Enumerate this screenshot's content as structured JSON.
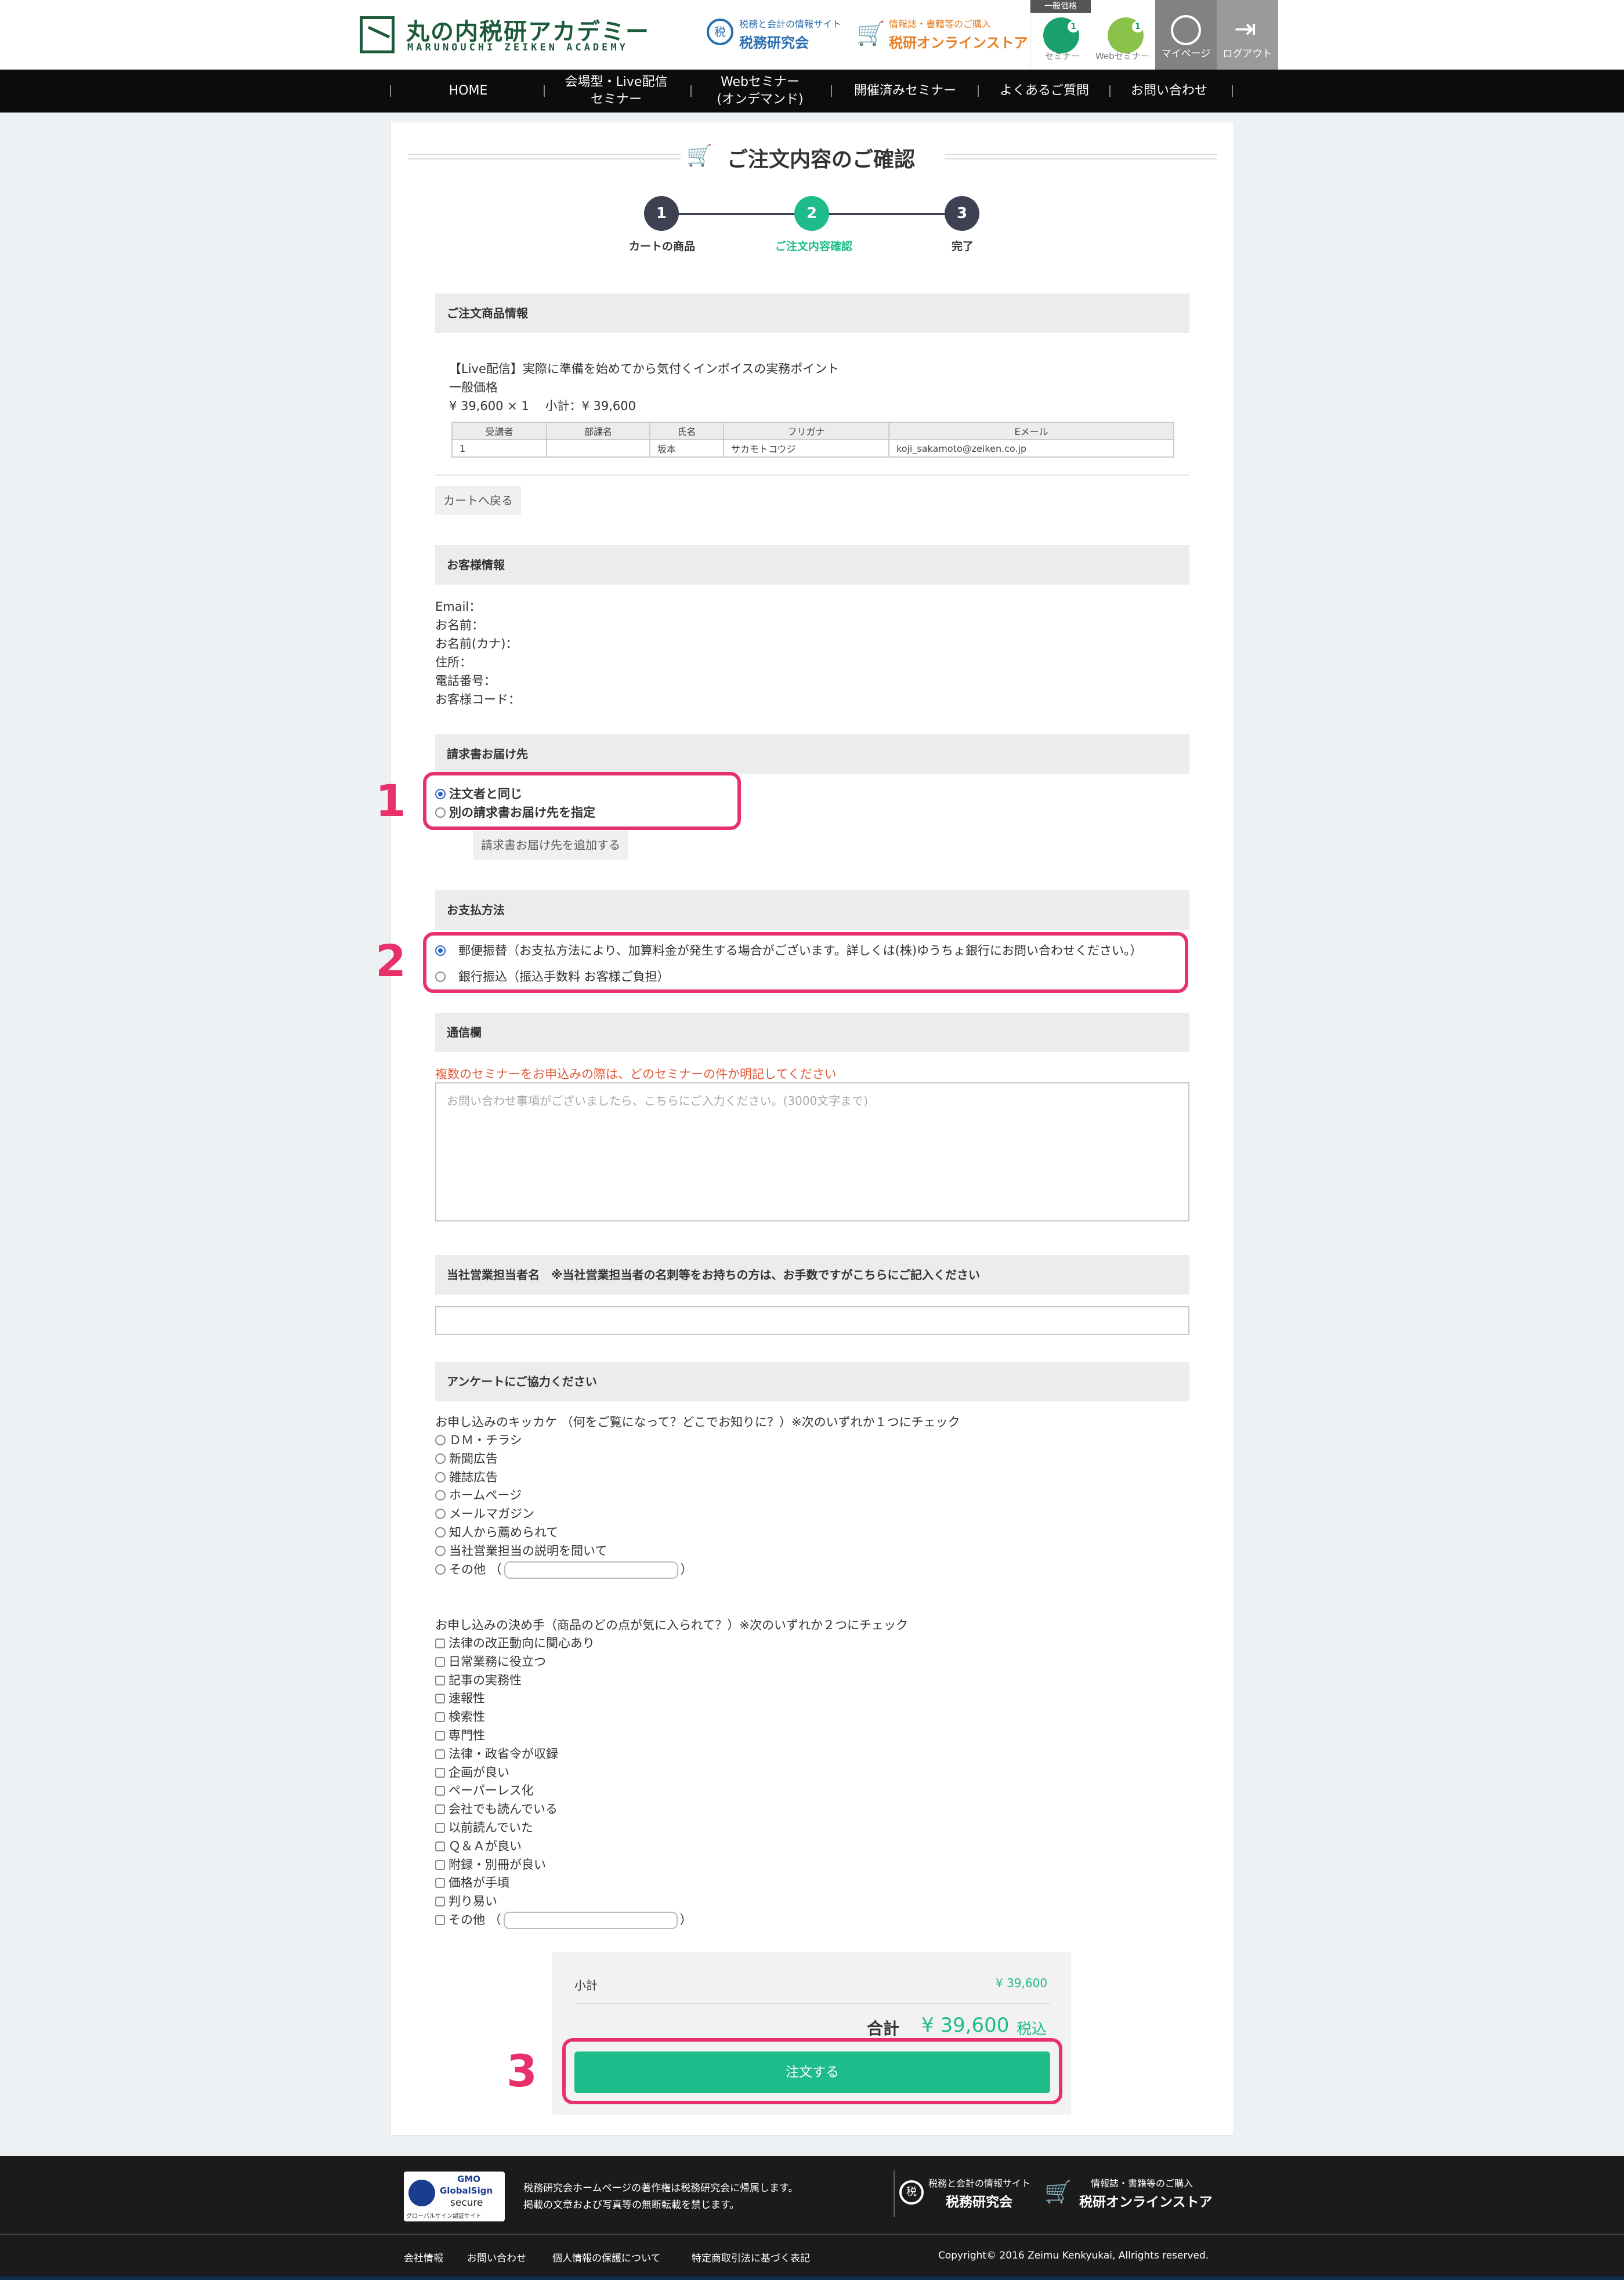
{
  "header": {
    "logo_title": "丸の内税研アカデミー",
    "logo_sub": "MARUNOUCHI ZEIKEN ACADEMY",
    "site1_small": "税務と会計の情報サイト",
    "site1_name": "税務研究会",
    "site2_small": "情報誌・書籍等のご購入",
    "site2_name": "税研オンラインストア",
    "price_type": "一般価格",
    "cart_seminar_count": "1",
    "cart_seminar_label": "セミナー",
    "cart_web_count": "1",
    "cart_web_label": "Webセミナー",
    "mypage": "マイページ",
    "logout": "ログアウト"
  },
  "nav": {
    "items": [
      "HOME",
      "会場型・Live配信\nセミナー",
      "Webセミナー\n(オンデマンド)",
      "開催済みセミナー",
      "よくあるご質問",
      "お問い合わせ"
    ]
  },
  "page": {
    "title": "ご注文内容のご確認",
    "steps": [
      {
        "num": "1",
        "label": "カートの商品"
      },
      {
        "num": "2",
        "label": "ご注文内容確認"
      },
      {
        "num": "3",
        "label": "完了"
      }
    ]
  },
  "order": {
    "section_title": "ご注文商品情報",
    "product_name": "【Live配信】実際に準備を始めてから気付くインボイスの実務ポイント",
    "price_label": "一般価格",
    "price_line": "¥ 39,600 × 1　 小計：¥ 39,600",
    "table_headers": [
      "受講者",
      "部課名",
      "氏名",
      "フリガナ",
      "Eメール"
    ],
    "table_rows": [
      [
        "1",
        "",
        "坂本",
        "サカモトコウジ",
        "koji_sakamoto@zeiken.co.jp"
      ]
    ],
    "back_button": "カートへ戻る"
  },
  "customer": {
    "section_title": "お客様情報",
    "fields": [
      "Email：",
      "お名前：",
      "お名前(カナ)：",
      "住所：",
      "電話番号：",
      "お客様コード："
    ]
  },
  "invoice": {
    "section_title": "請求書お届け先",
    "options": [
      "注文者と同じ",
      "別の請求書お届け先を指定"
    ],
    "selected": 0,
    "add_button": "請求書お届け先を追加する"
  },
  "payment": {
    "section_title": "お支払方法",
    "options": [
      "郵便振替（お支払方法により、加算料金が発生する場合がございます。詳しくは(株)ゆうちょ銀行にお問い合わせください。）",
      "銀行振込（振込手数料 お客様ご負担）"
    ],
    "selected": 0
  },
  "message": {
    "section_title": "通信欄",
    "note": "複数のセミナーをお申込みの際は、どのセミナーの件か明記してください",
    "placeholder": "お問い合わせ事項がございましたら、こちらにご入力ください。(3000文字まで)"
  },
  "sales_rep": {
    "section_title": "当社営業担当者名　※当社営業担当者の名刺等をお持ちの方は、お手数ですがこちらにご記入ください",
    "value": ""
  },
  "survey": {
    "section_title": "アンケートにご協力ください",
    "q1": "お申し込みのキッカケ （何をご覧になって？どこでお知りに？）※次のいずれか１つにチェック",
    "q1_options": [
      "ＤＭ・チラシ",
      "新聞広告",
      "雑誌広告",
      "ホームページ",
      "メールマガジン",
      "知人から薦められて",
      "当社営業担当の説明を聞いて",
      "その他 （"
    ],
    "q2": "お申し込みの決め手（商品のどの点が気に入られて？）※次のいずれか２つにチェック",
    "q2_options": [
      "法律の改正動向に関心あり",
      "日常業務に役立つ",
      "記事の実務性",
      "速報性",
      "検索性",
      "専門性",
      "法律・政省令が収録",
      "企画が良い",
      "ペーパーレス化",
      "会社でも読んでいる",
      "以前読んでいた",
      "Ｑ＆Ａが良い",
      "附録・別冊が良い",
      "価格が手頃",
      "判り易い",
      "その他 （"
    ],
    "close_paren": "）"
  },
  "summary": {
    "subtotal_label": "小計",
    "subtotal_value": "¥ 39,600",
    "total_label": "合計",
    "total_value": "¥ 39,600",
    "tax_label": "税込",
    "order_button": "注文する"
  },
  "annotations": [
    "1",
    "2",
    "3"
  ],
  "footer": {
    "badge_top": "GMO",
    "badge_brand": "GlobalSign",
    "badge_secure": "secure",
    "badge_sub": "グローバルサイン認証サイト",
    "copyright_line1": "税務研究会ホームページの著作権は税務研究会に帰属します。",
    "copyright_line2": "掲載の文章および写真等の無断転載を禁じます。",
    "site1_small": "税務と会計の情報サイト",
    "site1_name": "税務研究会",
    "site2_small": "情報誌・書籍等のご購入",
    "site2_name": "税研オンラインストア",
    "links": [
      "会社情報",
      "お問い合わせ",
      "個人情報の保護について",
      "特定商取引法に基づく表記"
    ],
    "copyright": "Copyright© 2016 Zeimu Kenkyukai, Allrights reserved."
  },
  "colors": {
    "accent": "#1ebc8a",
    "annotation": "#e8306a",
    "step_inactive": "#3d4151",
    "nav_bg": "#0c0c0c"
  }
}
